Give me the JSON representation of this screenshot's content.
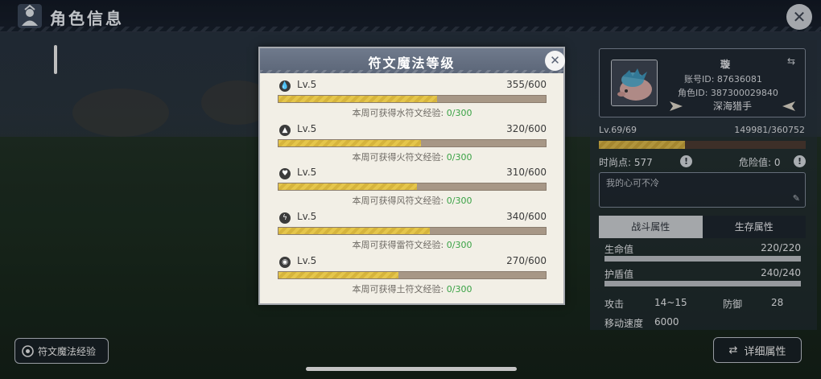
{
  "header": {
    "title": "角色信息",
    "close_icon": "close-x-icon"
  },
  "rune_exp_button": {
    "label": "符文魔法经验",
    "icon": "rune-icon"
  },
  "profile": {
    "name": "璇",
    "account_id": "账号ID: 87636081",
    "role_id": "角色ID: 387300029840",
    "title": "深海猎手",
    "level": "Lv.69/69",
    "exp": "149981/360752",
    "exp_fraction": 0.416,
    "fashion": "时尚点: 577",
    "danger": "危险值: 0",
    "signature": "我的心可不冷"
  },
  "tabs": [
    {
      "label": "战斗属性",
      "active": true
    },
    {
      "label": "生存属性",
      "active": false
    }
  ],
  "stats": {
    "hp_label": "生命值",
    "hp_value": "220/220",
    "shield_label": "护盾值",
    "shield_value": "240/240",
    "attack_label": "攻击",
    "attack_value": "14~15",
    "defense_label": "防御",
    "defense_value": "28",
    "speed_label": "移动速度",
    "speed_value": "6000"
  },
  "detail_button": {
    "label": "详细属性"
  },
  "modal": {
    "title": "符文魔法等级",
    "runes": [
      {
        "element": "water",
        "icon": "water-drop-icon",
        "level": "Lv.5",
        "progress": "355/600",
        "fraction": 0.592,
        "note": "本周可获得水符文经验: ",
        "note_value": "0/300"
      },
      {
        "element": "fire",
        "icon": "flame-icon",
        "level": "Lv.5",
        "progress": "320/600",
        "fraction": 0.533,
        "note": "本周可获得火符文经验: ",
        "note_value": "0/300"
      },
      {
        "element": "wind",
        "icon": "wind-icon",
        "level": "Lv.5",
        "progress": "310/600",
        "fraction": 0.517,
        "note": "本周可获得风符文经验: ",
        "note_value": "0/300"
      },
      {
        "element": "thunder",
        "icon": "lightning-icon",
        "level": "Lv.5",
        "progress": "340/600",
        "fraction": 0.567,
        "note": "本周可获得雷符文经验: ",
        "note_value": "0/300"
      },
      {
        "element": "earth",
        "icon": "earth-icon",
        "level": "Lv.5",
        "progress": "270/600",
        "fraction": 0.45,
        "note": "本周可获得土符文经验: ",
        "note_value": "0/300"
      }
    ]
  },
  "colors": {
    "accent_gold": "#e5c64b",
    "green": "#3aa245",
    "modal_bg": "#f2efe6",
    "header_blue": "#6f7a8c"
  }
}
